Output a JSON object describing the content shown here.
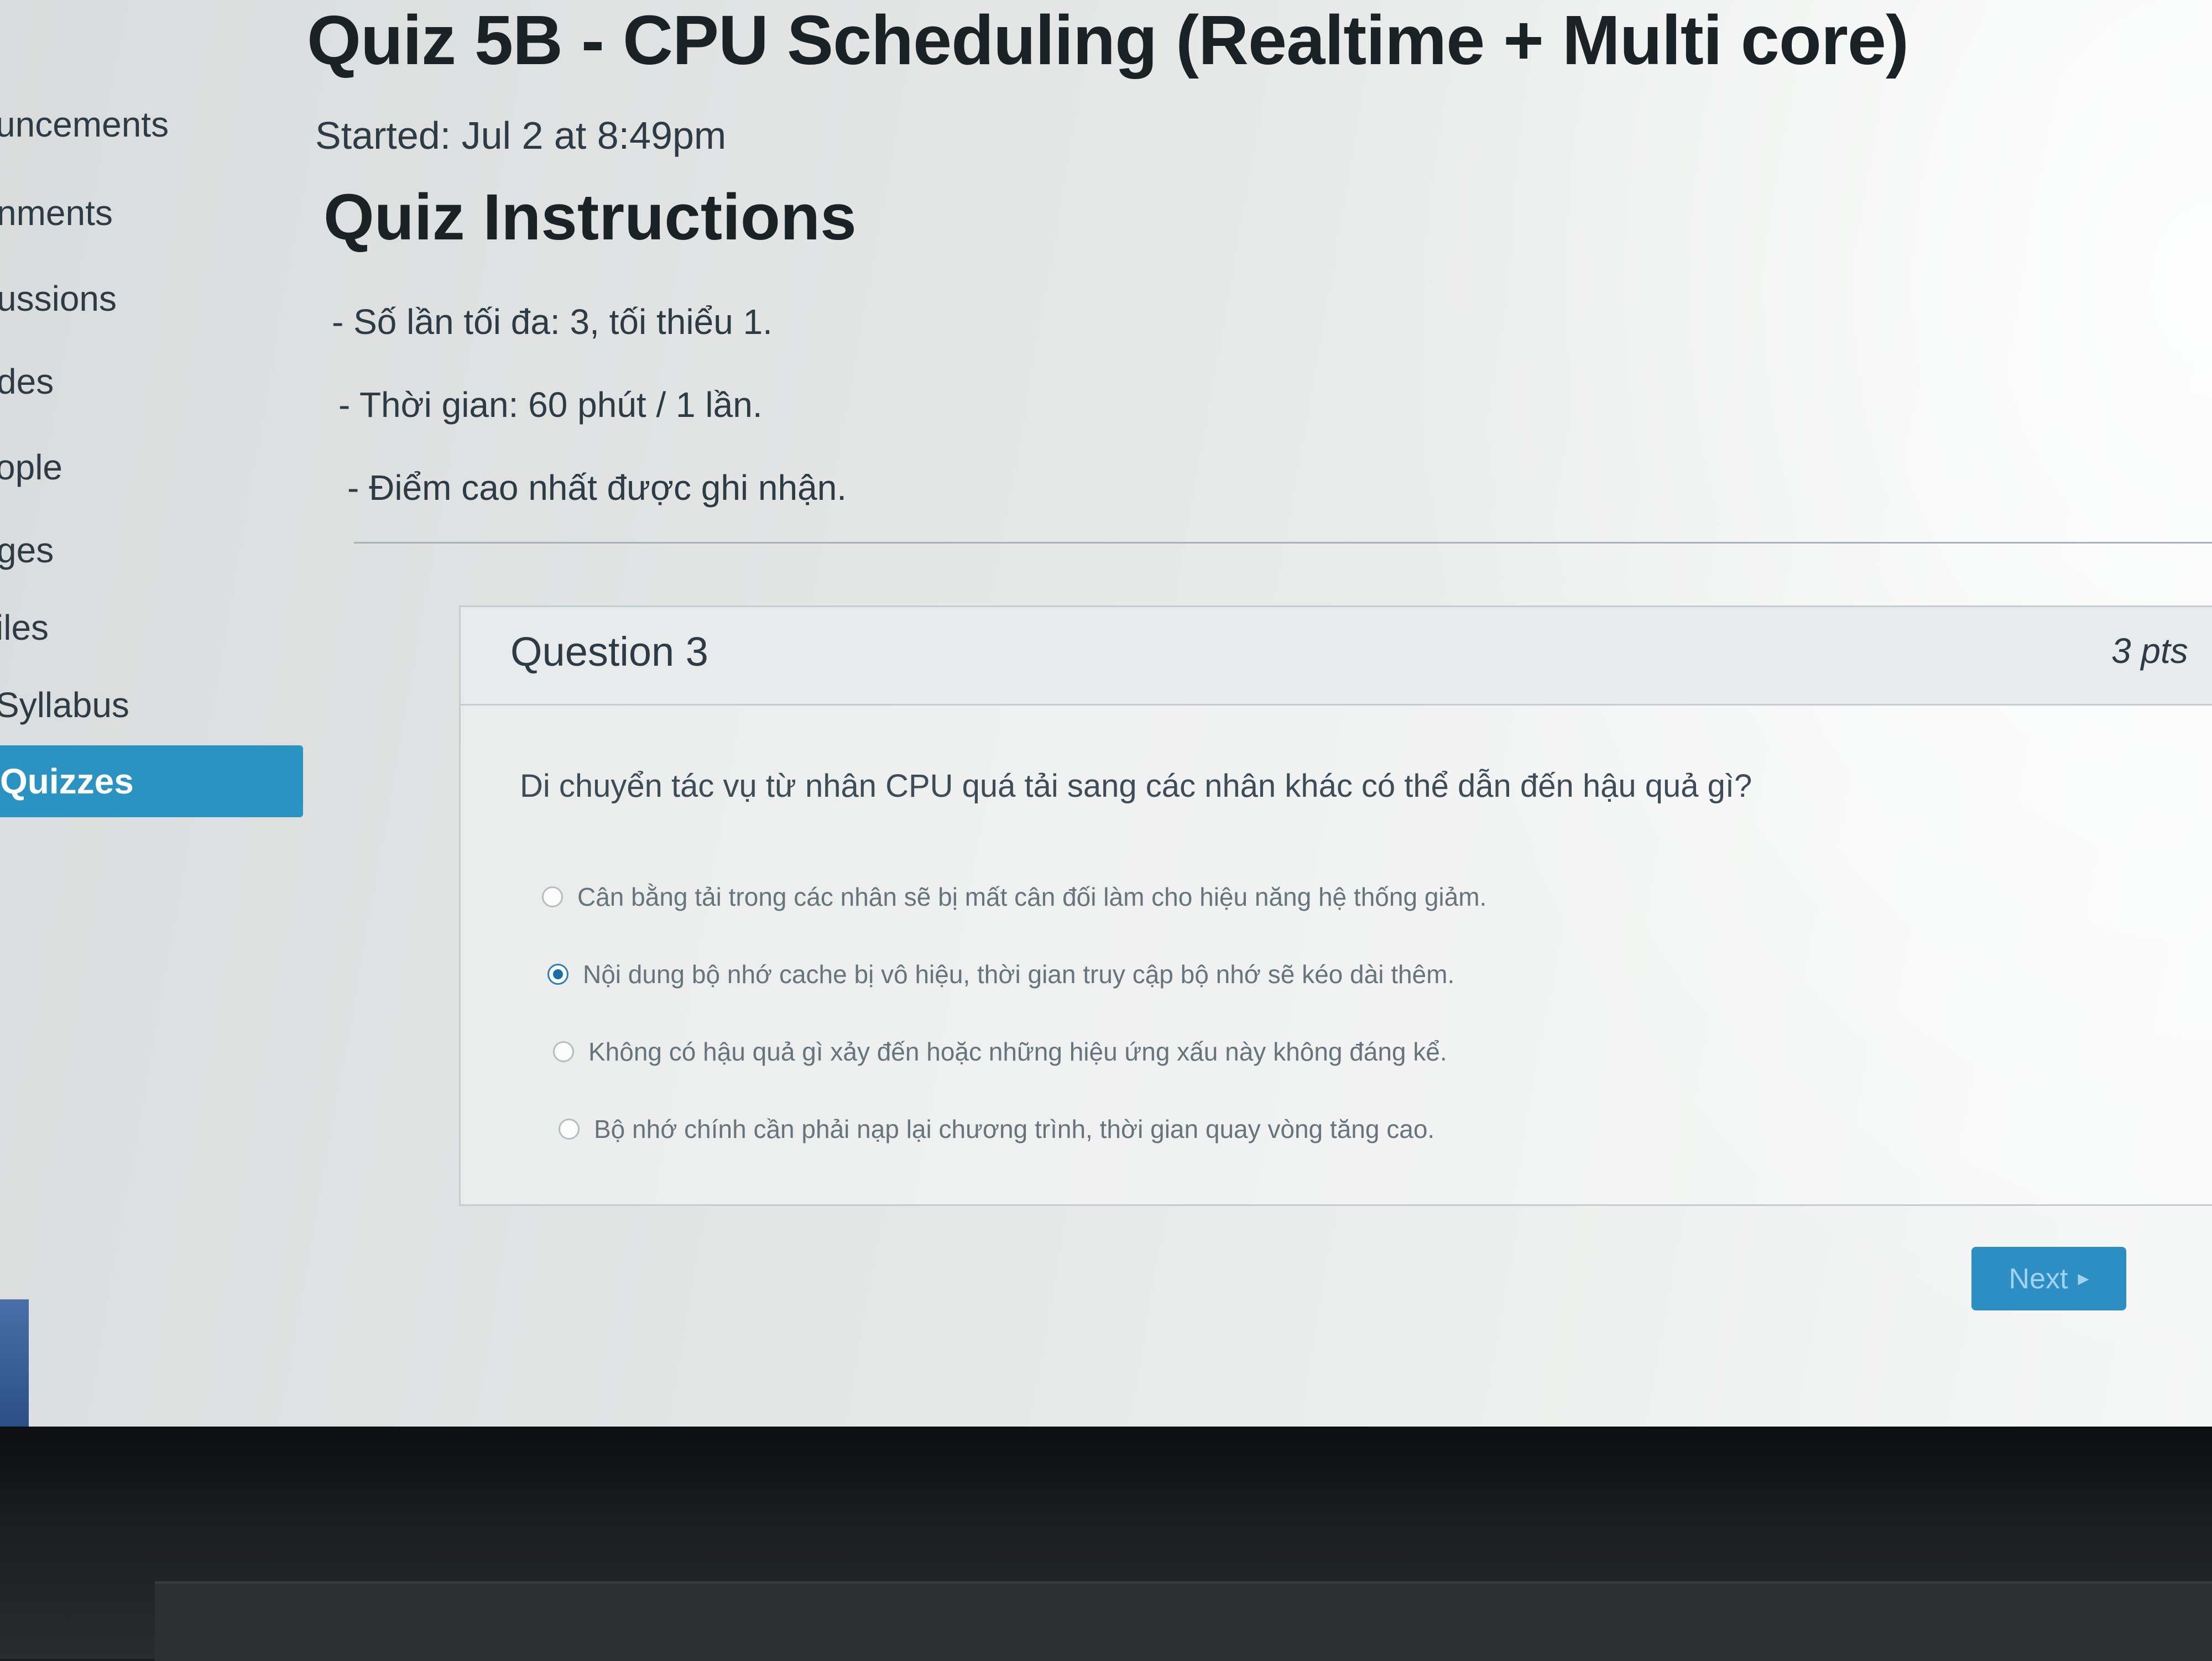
{
  "sidebar": {
    "items": [
      {
        "label": "uncements"
      },
      {
        "label": "nments"
      },
      {
        "label": "ussions"
      },
      {
        "label": "des"
      },
      {
        "label": "ople"
      },
      {
        "label": "ges"
      },
      {
        "label": "iles"
      },
      {
        "label": "Syllabus"
      },
      {
        "label": "Quizzes",
        "active": true
      }
    ]
  },
  "page": {
    "title": "Quiz 5B - CPU Scheduling (Realtime + Multi core)",
    "started": "Started: Jul 2 at 8:49pm",
    "instructions_heading": "Quiz Instructions",
    "instructions": [
      "- Số lần tối đa: 3, tối thiểu 1.",
      "- Thời gian: 60 phút / 1 lần.",
      "- Điểm cao nhất được ghi nhận."
    ]
  },
  "question": {
    "title": "Question 3",
    "points": "3 pts",
    "text": "Di chuyển tác vụ từ nhân CPU quá tải sang các nhân khác có thể dẫn đến hậu quả gì?",
    "answers": [
      {
        "text": "Cân bằng tải trong các nhân sẽ bị mất cân đối làm cho hiệu năng hệ thống giảm.",
        "selected": false
      },
      {
        "text": "Nội dung bộ nhớ cache bị vô hiệu, thời gian truy cập bộ nhớ sẽ kéo dài thêm.",
        "selected": true
      },
      {
        "text": "Không có hậu quả gì xảy đến hoặc những hiệu ứng xấu này không đáng kể.",
        "selected": false
      },
      {
        "text": "Bộ nhớ chính cần phải nạp lại chương trình, thời gian quay vòng tăng cao.",
        "selected": false
      }
    ]
  },
  "footer": {
    "next_label": "Next",
    "next_icon": "triangle-right-icon"
  },
  "colors": {
    "accent": "#2a93c1",
    "text": "#2d3b45"
  }
}
